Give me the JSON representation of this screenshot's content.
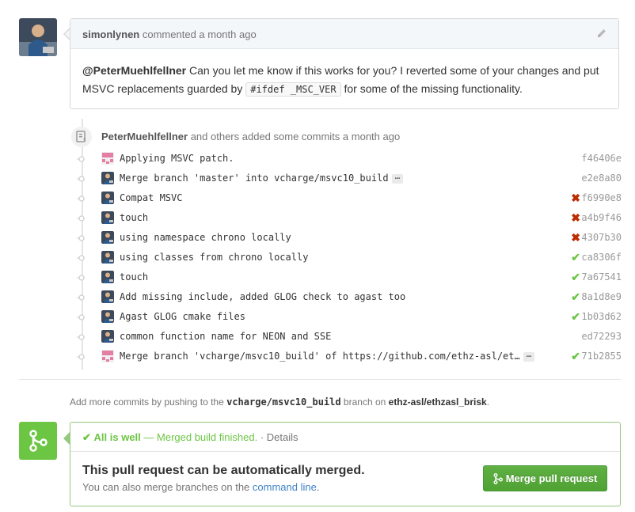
{
  "comment": {
    "author": "simonlynen",
    "meta": "commented a month ago",
    "mention": "@PeterMuehlfellner",
    "text_1": " Can you let me know if this works for you? I reverted some of your changes and put MSVC replacements guarded by ",
    "code": "#ifdef _MSC_VER",
    "text_2": " for some of the missing functionality."
  },
  "commits_header": {
    "author": "PeterMuehlfellner",
    "text": " and others added some commits a month ago"
  },
  "commits": [
    {
      "message": "Applying MSVC patch.",
      "sha": "f46406e",
      "status": "none",
      "avatar": "identicon",
      "truncated": false
    },
    {
      "message": "Merge branch 'master' into vcharge/msvc10_build",
      "sha": "e2e8a80",
      "status": "none",
      "avatar": "photo",
      "truncated": true
    },
    {
      "message": "Compat MSVC",
      "sha": "f6990e8",
      "status": "fail",
      "avatar": "photo",
      "truncated": false
    },
    {
      "message": "touch",
      "sha": "a4b9f46",
      "status": "fail",
      "avatar": "photo",
      "truncated": false
    },
    {
      "message": "using namespace chrono locally",
      "sha": "4307b30",
      "status": "fail",
      "avatar": "photo",
      "truncated": false
    },
    {
      "message": "using classes from chrono locally",
      "sha": "ca8306f",
      "status": "ok",
      "avatar": "photo",
      "truncated": false
    },
    {
      "message": "touch",
      "sha": "7a67541",
      "status": "ok",
      "avatar": "photo",
      "truncated": false
    },
    {
      "message": "Add missing include, added GLOG check to agast too",
      "sha": "8a1d8e9",
      "status": "ok",
      "avatar": "photo",
      "truncated": false
    },
    {
      "message": "Agast GLOG cmake files",
      "sha": "1b03d62",
      "status": "ok",
      "avatar": "photo",
      "truncated": false
    },
    {
      "message": "common function name for NEON and SSE",
      "sha": "ed72293",
      "status": "none",
      "avatar": "photo",
      "truncated": false
    },
    {
      "message": "Merge branch 'vcharge/msvc10_build' of https://github.com/ethz-asl/et…",
      "sha": "71b2855",
      "status": "ok",
      "avatar": "identicon",
      "truncated": true
    }
  ],
  "status_glyphs": {
    "fail": "✖",
    "ok": "✔",
    "none": ""
  },
  "ellipsis": "…",
  "push_note": {
    "prefix": "Add more commits by pushing to the ",
    "branch": "vcharge/msvc10_build",
    "middle": " branch on ",
    "repo": "ethz-asl/ethzasl_brisk",
    "suffix": "."
  },
  "merge": {
    "status_check": "✔",
    "status_ok": "All is well",
    "status_detail": " — Merged build finished.",
    "status_sep": " · ",
    "details_link": "Details",
    "title": "This pull request can be automatically merged.",
    "sub_prefix": "You can also merge branches on the ",
    "sub_link": "command line",
    "sub_suffix": ".",
    "button": "Merge pull request"
  },
  "colors": {
    "success": "#6cc644",
    "failure": "#bd2c00",
    "link": "#4183c4",
    "merge_button": "#60b044"
  }
}
